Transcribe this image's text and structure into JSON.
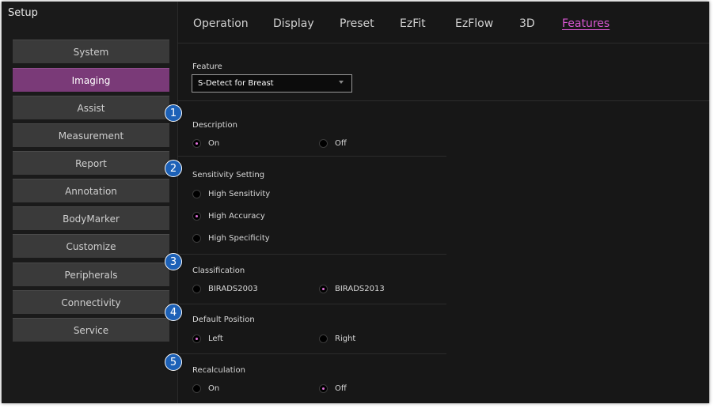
{
  "sidebar": {
    "title": "Setup",
    "items": [
      {
        "label": "System",
        "active": false
      },
      {
        "label": "Imaging",
        "active": true
      },
      {
        "label": "Assist",
        "active": false
      },
      {
        "label": "Measurement",
        "active": false
      },
      {
        "label": "Report",
        "active": false
      },
      {
        "label": "Annotation",
        "active": false
      },
      {
        "label": "BodyMarker",
        "active": false
      },
      {
        "label": "Customize",
        "active": false
      },
      {
        "label": "Peripherals",
        "active": false
      },
      {
        "label": "Connectivity",
        "active": false
      },
      {
        "label": "Service",
        "active": false
      }
    ]
  },
  "tabs": [
    {
      "label": "Operation",
      "active": false
    },
    {
      "label": "Display",
      "active": false
    },
    {
      "label": "Preset",
      "active": false
    },
    {
      "label": "EzFit",
      "active": false
    },
    {
      "label": "EzFlow",
      "active": false
    },
    {
      "label": "3D",
      "active": false
    },
    {
      "label": "Features",
      "active": true
    }
  ],
  "feature": {
    "label": "Feature",
    "selected": "S-Detect for Breast"
  },
  "sections": {
    "description": {
      "badge": "1",
      "label": "Description",
      "options": [
        {
          "label": "On",
          "selected": true
        },
        {
          "label": "Off",
          "selected": false
        }
      ]
    },
    "sensitivity": {
      "badge": "2",
      "label": "Sensitivity Setting",
      "options": [
        {
          "label": "High Sensitivity",
          "selected": false
        },
        {
          "label": "High Accuracy",
          "selected": true
        },
        {
          "label": "High Specificity",
          "selected": false
        }
      ]
    },
    "classification": {
      "badge": "3",
      "label": "Classification",
      "options": [
        {
          "label": "BIRADS2003",
          "selected": false
        },
        {
          "label": "BIRADS2013",
          "selected": true
        }
      ]
    },
    "default_position": {
      "badge": "4",
      "label": "Default Position",
      "options": [
        {
          "label": "Left",
          "selected": true
        },
        {
          "label": "Right",
          "selected": false
        }
      ]
    },
    "recalculation": {
      "badge": "5",
      "label": "Recalculation",
      "options": [
        {
          "label": "On",
          "selected": false
        },
        {
          "label": "Off",
          "selected": true
        }
      ]
    }
  },
  "colors": {
    "accent": "#d957d3",
    "active_item": "#7a3a78",
    "badge": "#1d61b7"
  }
}
